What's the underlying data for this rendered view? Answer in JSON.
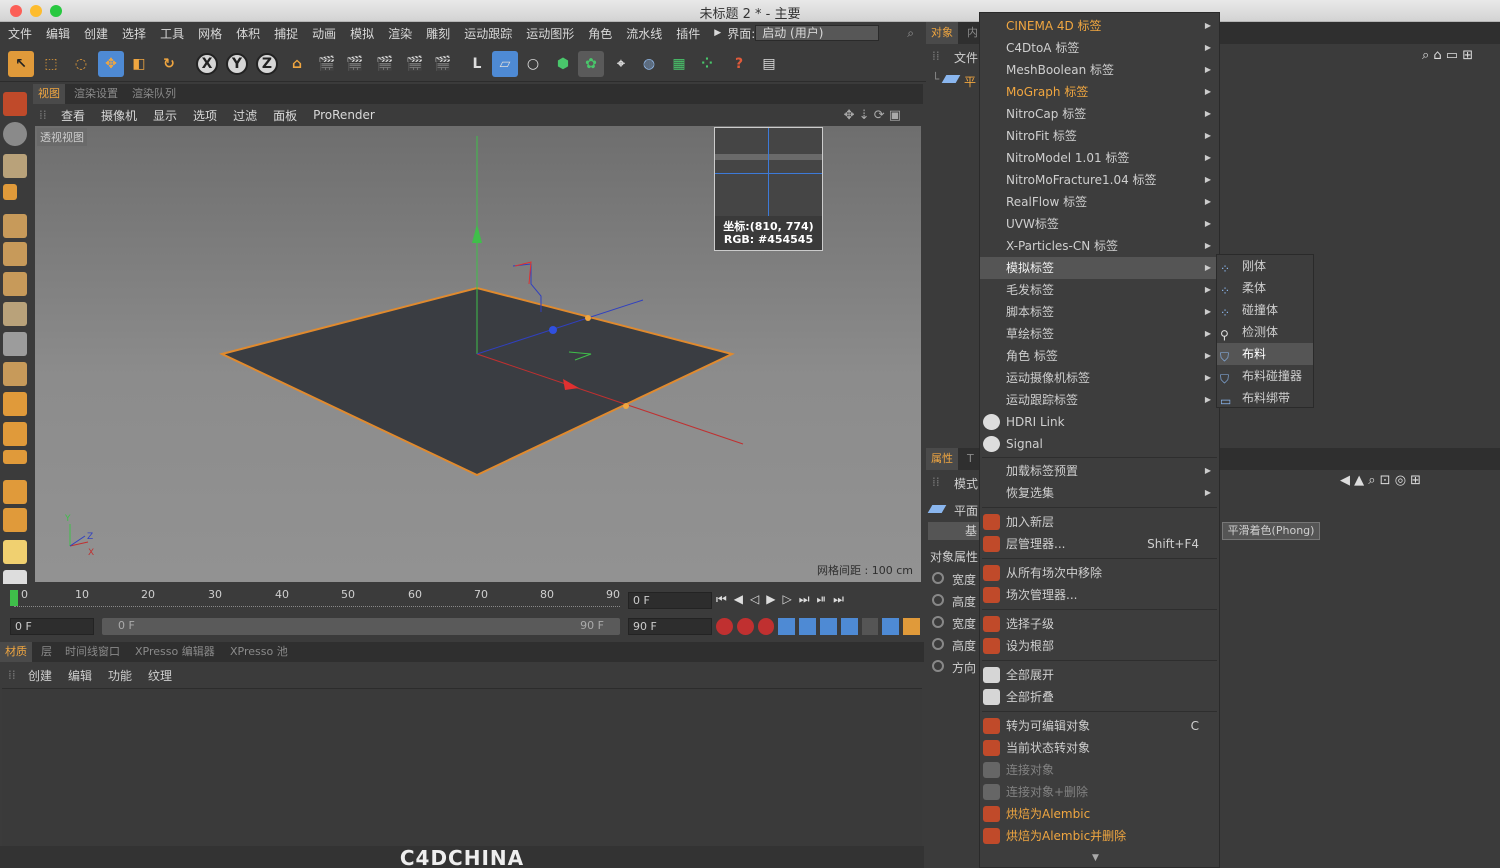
{
  "window": {
    "title": "未标题 2 * - 主要"
  },
  "menubar": {
    "items": [
      "文件",
      "编辑",
      "创建",
      "选择",
      "工具",
      "网格",
      "体积",
      "捕捉",
      "动画",
      "模拟",
      "渲染",
      "雕刻",
      "运动跟踪",
      "运动图形",
      "角色",
      "流水线",
      "插件"
    ],
    "layout_label": "界面:",
    "layout_value": "启动 (用户)"
  },
  "view_tabs": [
    "视图",
    "渲染设置",
    "渲染队列"
  ],
  "view_menu": [
    "查看",
    "摄像机",
    "显示",
    "选项",
    "过滤",
    "面板",
    "ProRender"
  ],
  "viewport": {
    "label": "透视视图",
    "grid_spacing": "网格间距 : 100 cm",
    "color_picker": {
      "coords": "坐标:(810, 774)",
      "rgb": "RGB: #454545"
    },
    "axis_y": "Y",
    "axis_x": "X",
    "axis_z": "Z"
  },
  "timeline": {
    "ticks": [
      "0",
      "10",
      "20",
      "30",
      "40",
      "50",
      "60",
      "70",
      "80",
      "90"
    ],
    "current_frame": "0 F",
    "start_field": "0 F",
    "range_start": "0 F",
    "range_end": "90 F",
    "end_field": "90 F",
    "max_field": "90 F"
  },
  "material_tabs": [
    "材质",
    "层",
    "时间线窗口",
    "XPresso 编辑器",
    "XPresso 池"
  ],
  "material_menu": [
    "创建",
    "编辑",
    "功能",
    "纹理"
  ],
  "right_panel": {
    "tabs_top": [
      "对象",
      "内"
    ],
    "file_label": "文件",
    "object_label": "平",
    "tabs_attr": [
      "属性",
      "T"
    ],
    "mode_label": "模式",
    "obj_name": "平面",
    "basic_tab": "基",
    "phong_tab": "平滑着色(Phong)",
    "object_props": "对象属性",
    "props": [
      "宽度",
      "高度",
      "宽度",
      "高度",
      "方向"
    ]
  },
  "context_menu": {
    "items": [
      {
        "label": "CINEMA 4D 标签",
        "submenu": true,
        "style": "orange"
      },
      {
        "label": "C4DtoA 标签",
        "submenu": true
      },
      {
        "label": "MeshBoolean 标签",
        "submenu": true
      },
      {
        "label": "MoGraph 标签",
        "submenu": true,
        "style": "orange"
      },
      {
        "label": "NitroCap 标签",
        "submenu": true
      },
      {
        "label": "NitroFit 标签",
        "submenu": true
      },
      {
        "label": "NitroModel 1.01 标签",
        "submenu": true
      },
      {
        "label": "NitroMoFracture1.04 标签",
        "submenu": true
      },
      {
        "label": "RealFlow 标签",
        "submenu": true
      },
      {
        "label": "UVW标签",
        "submenu": true
      },
      {
        "label": "X-Particles-CN 标签",
        "submenu": true
      },
      {
        "label": "模拟标签",
        "submenu": true,
        "selected": true
      },
      {
        "label": "毛发标签",
        "submenu": true
      },
      {
        "label": "脚本标签",
        "submenu": true
      },
      {
        "label": "草绘标签",
        "submenu": true
      },
      {
        "label": "角色 标签",
        "submenu": true
      },
      {
        "label": "运动摄像机标签",
        "submenu": true
      },
      {
        "label": "运动跟踪标签",
        "submenu": true
      },
      {
        "label": "HDRI Link",
        "icon": "hdri-link-icon"
      },
      {
        "label": "Signal",
        "icon": "signal-icon"
      }
    ],
    "group2": [
      {
        "label": "加载标签预置",
        "submenu": true
      },
      {
        "label": "恢复选集",
        "submenu": true
      }
    ],
    "group3": [
      {
        "label": "加入新层",
        "icon": "layer-add-icon"
      },
      {
        "label": "层管理器...",
        "shortcut": "Shift+F4",
        "icon": "layer-manager-icon"
      }
    ],
    "group4": [
      {
        "label": "从所有场次中移除",
        "icon": "take-remove-icon"
      },
      {
        "label": "场次管理器...",
        "icon": "take-manager-icon"
      }
    ],
    "group5": [
      {
        "label": "选择子级",
        "icon": "select-children-icon"
      },
      {
        "label": "设为根部",
        "icon": "set-root-icon"
      }
    ],
    "group6": [
      {
        "label": "全部展开",
        "icon": "expand-all-icon"
      },
      {
        "label": "全部折叠",
        "icon": "collapse-all-icon"
      }
    ],
    "group7": [
      {
        "label": "转为可编辑对象",
        "shortcut": "C",
        "icon": "make-editable-icon"
      },
      {
        "label": "当前状态转对象",
        "icon": "current-state-icon"
      },
      {
        "label": "连接对象",
        "style": "gray",
        "icon": "connect-icon"
      },
      {
        "label": "连接对象+删除",
        "style": "gray",
        "icon": "connect-delete-icon"
      },
      {
        "label": "烘焙为Alembic",
        "style": "orange",
        "icon": "alembic-icon"
      },
      {
        "label": "烘焙为Alembic并删除",
        "style": "orange",
        "icon": "alembic-delete-icon"
      }
    ]
  },
  "submenu": {
    "items": [
      {
        "label": "刚体",
        "icon": "rigid-body-icon"
      },
      {
        "label": "柔体",
        "icon": "soft-body-icon"
      },
      {
        "label": "碰撞体",
        "icon": "collider-icon"
      },
      {
        "label": "检测体",
        "icon": "ghost-icon"
      },
      {
        "label": "布料",
        "icon": "cloth-icon",
        "selected": true
      },
      {
        "label": "布料碰撞器",
        "icon": "cloth-collider-icon"
      },
      {
        "label": "布料绑带",
        "icon": "cloth-belt-icon"
      }
    ]
  },
  "watermark": "C4DCHINA",
  "colors": {
    "accent": "#f0a640",
    "bg": "#3b3b3b",
    "menu_bg": "#3d3d3d",
    "plane": "#3a3d42",
    "edge": "#e08a2e"
  }
}
